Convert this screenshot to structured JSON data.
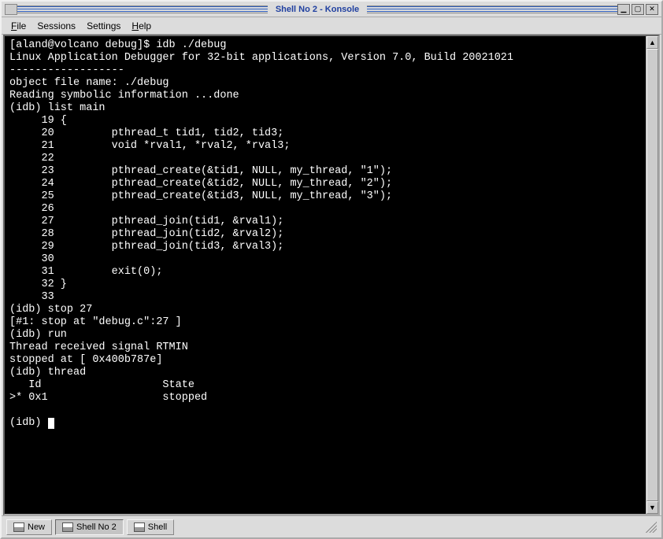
{
  "window": {
    "title": "Shell No 2 - Konsole"
  },
  "menu": {
    "file": "File",
    "sessions": "Sessions",
    "settings": "Settings",
    "help": "Help"
  },
  "terminal": {
    "lines": [
      "[aland@volcano debug]$ idb ./debug",
      "Linux Application Debugger for 32-bit applications, Version 7.0, Build 20021021",
      "------------------",
      "object file name: ./debug",
      "Reading symbolic information ...done",
      "(idb) list main",
      "     19 {",
      "     20         pthread_t tid1, tid2, tid3;",
      "     21         void *rval1, *rval2, *rval3;",
      "     22",
      "     23         pthread_create(&tid1, NULL, my_thread, \"1\");",
      "     24         pthread_create(&tid2, NULL, my_thread, \"2\");",
      "     25         pthread_create(&tid3, NULL, my_thread, \"3\");",
      "     26",
      "     27         pthread_join(tid1, &rval1);",
      "     28         pthread_join(tid2, &rval2);",
      "     29         pthread_join(tid3, &rval3);",
      "     30",
      "     31         exit(0);",
      "     32 }",
      "     33",
      "(idb) stop 27",
      "[#1: stop at \"debug.c\":27 ]",
      "(idb) run",
      "Thread received signal RTMIN",
      "stopped at [ 0x400b787e]",
      "(idb) thread",
      "   Id                   State",
      ">* 0x1                  stopped",
      "",
      "(idb) "
    ]
  },
  "tabs": {
    "new": "New",
    "shell2": "Shell No 2",
    "shell": "Shell"
  }
}
